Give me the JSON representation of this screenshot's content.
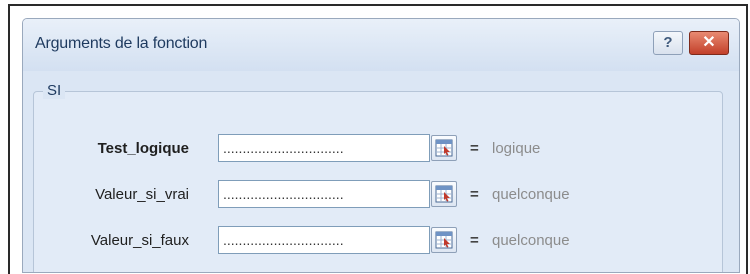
{
  "dialog": {
    "title": "Arguments de la fonction",
    "help_label": "?",
    "close_label": "✕"
  },
  "function": {
    "name": "SI",
    "arguments": [
      {
        "label": "Test_logique",
        "value": "...............................",
        "result": "logique"
      },
      {
        "label": "Valeur_si_vrai",
        "value": "...............................",
        "result": "quelconque"
      },
      {
        "label": "Valeur_si_faux",
        "value": "...............................",
        "result": "quelconque"
      }
    ],
    "equals": "="
  },
  "icons": {
    "range_selector": "collapse-dialog-range-icon",
    "help": "help-icon",
    "close": "close-icon"
  },
  "colors": {
    "title_text": "#1e3a5f",
    "dialog_background": "#dbe6f4",
    "close_button": "#c2402a",
    "result_text": "#8c8c8c"
  }
}
